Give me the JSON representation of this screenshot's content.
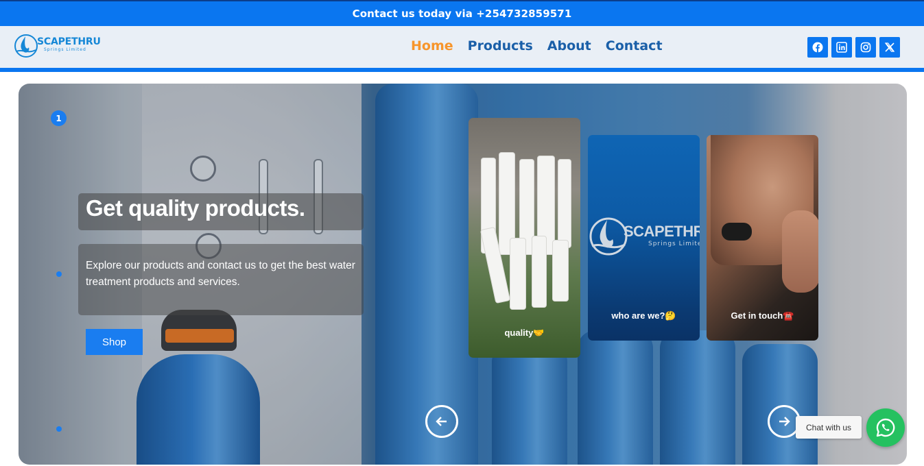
{
  "topbar": {
    "text": "Contact us today via +254732859571"
  },
  "brand": {
    "name": "SCAPETHRU",
    "tagline": "Springs Limited",
    "accent": "#1587d6"
  },
  "nav": {
    "items": [
      {
        "label": "Home",
        "active": true
      },
      {
        "label": "Products",
        "active": false
      },
      {
        "label": "About",
        "active": false
      },
      {
        "label": "Contact",
        "active": false
      }
    ]
  },
  "socials": [
    "facebook-icon",
    "linkedin-icon",
    "instagram-icon",
    "x-icon"
  ],
  "hero": {
    "step_number": "1",
    "headline": "Get quality products.",
    "subtext": "Explore our products and contact us to get the best water treatment products and services.",
    "cta_label": "Shop"
  },
  "cards": [
    {
      "label": "quality🤝"
    },
    {
      "label": "who are we?🤔",
      "logo_name": "SCAPETHRU",
      "logo_tagline": "Springs Limited"
    },
    {
      "label": "Get in touch☎️"
    }
  ],
  "chat": {
    "label": "Chat with us"
  },
  "colors": {
    "primary": "#0a76f0",
    "nav_active": "#f7952b",
    "nav_link": "#1a5fa8",
    "whatsapp": "#25c160"
  }
}
